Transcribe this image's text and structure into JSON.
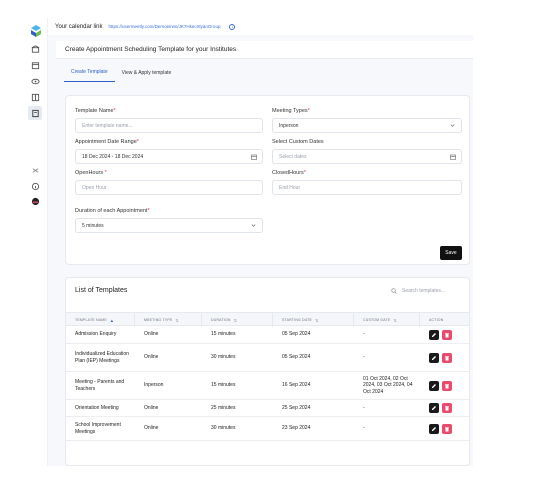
{
  "topbar": {
    "calendar_label": "Your calendar link",
    "calendar_url": "https://usermeetly.com/Demoeirwn/JK7Hkecr8yanGroup"
  },
  "colors": {
    "accent": "#2f5fcf",
    "delete": "#e84b6c",
    "save": "#111111"
  },
  "sidebar": {
    "icons": [
      "logo-icon",
      "home-icon",
      "calendar-icon",
      "eye-icon",
      "template-icon",
      "document-icon",
      "settings-icon",
      "info-icon",
      "user-icon"
    ]
  },
  "page": {
    "title": "Create Appointment Scheduling Template for your Institutes"
  },
  "tabs": [
    {
      "label": "Create Template",
      "active": true
    },
    {
      "label": "View & Apply template",
      "active": false
    }
  ],
  "form": {
    "template_name": {
      "label": "Template Name",
      "placeholder": "Enter template name..."
    },
    "meeting_types": {
      "label": "Meeting Types",
      "value": "Inperson"
    },
    "date_range": {
      "label": "Appointment Date Range",
      "value": "18 Dec 2024 - 18 Dec 2024"
    },
    "custom_dates": {
      "label": "Select Custom Dates",
      "placeholder": "Select dates"
    },
    "open_hours": {
      "label": "OpenHours",
      "placeholder": "Open Hour"
    },
    "closed_hours": {
      "label": "ClosedHours",
      "placeholder": "End Hour"
    },
    "duration": {
      "label": "Duration of each Appointment",
      "value": "5 minutes"
    },
    "save_label": "Save"
  },
  "list": {
    "title": "List of Templates",
    "search_placeholder": "Search templates...",
    "columns": [
      "TEMPLATE NAME",
      "MEETING TYPE",
      "DURATION",
      "STARTING DATE",
      "CUSTOM DATE",
      "ACTION"
    ],
    "rows": [
      {
        "name": "Admission Enquiry",
        "type": "Online",
        "duration": "15 minutes",
        "start": "05 Sep 2024",
        "custom": "-"
      },
      {
        "name": "Individualized Education Plan (IEP) Meetings",
        "type": "Online",
        "duration": "30 minutes",
        "start": "05 Sep 2024",
        "custom": "-"
      },
      {
        "name": "Meeting - Parents and Teachers",
        "type": "Inperson",
        "duration": "15 minutes",
        "start": "16 Sep 2024",
        "custom": "01 Oct 2024, 02 Oct 2024, 03 Oct 2024, 04 Oct 2024"
      },
      {
        "name": "Orientation Meeting",
        "type": "Online",
        "duration": "25 minutes",
        "start": "25 Sep 2024",
        "custom": "-"
      },
      {
        "name": "School Improvement Meetings",
        "type": "Online",
        "duration": "30 minutes",
        "start": "23 Sep 2024",
        "custom": "-"
      }
    ]
  }
}
